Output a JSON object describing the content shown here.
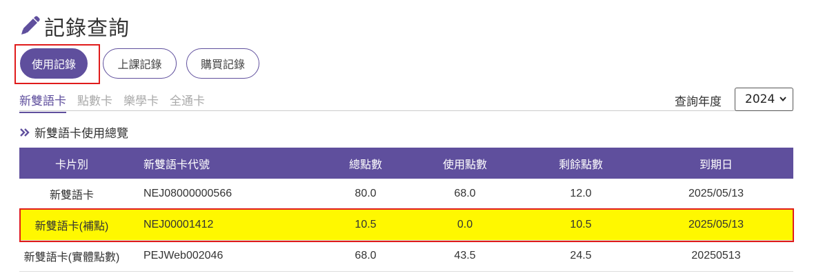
{
  "page": {
    "title": "記錄查詢"
  },
  "buttons": [
    {
      "label": "使用記錄",
      "active": true
    },
    {
      "label": "上課記錄",
      "active": false
    },
    {
      "label": "購買記錄",
      "active": false
    }
  ],
  "tabs": [
    {
      "label": "新雙語卡",
      "active": true
    },
    {
      "label": "點數卡",
      "active": false
    },
    {
      "label": "樂學卡",
      "active": false
    },
    {
      "label": "全通卡",
      "active": false
    }
  ],
  "year_filter": {
    "label": "查詢年度",
    "selected": "2024"
  },
  "section": {
    "title": "新雙語卡使用總覽"
  },
  "table": {
    "headers": [
      "卡片別",
      "新雙語卡代號",
      "總點數",
      "使用點數",
      "剩餘點數",
      "到期日"
    ],
    "rows": [
      [
        "新雙語卡",
        "NEJ08000000566",
        "80.0",
        "68.0",
        "12.0",
        "2025/05/13"
      ],
      [
        "新雙語卡(補點)",
        "NEJ00001412",
        "10.5",
        "0.0",
        "10.5",
        "2025/05/13"
      ],
      [
        "新雙語卡(實體點數)",
        "PEJWeb002046",
        "68.0",
        "43.5",
        "24.5",
        "20250513"
      ]
    ]
  },
  "colors": {
    "accent": "#5f4f9d",
    "highlight_row": "#fff800",
    "highlight_border": "#e01b1b"
  }
}
